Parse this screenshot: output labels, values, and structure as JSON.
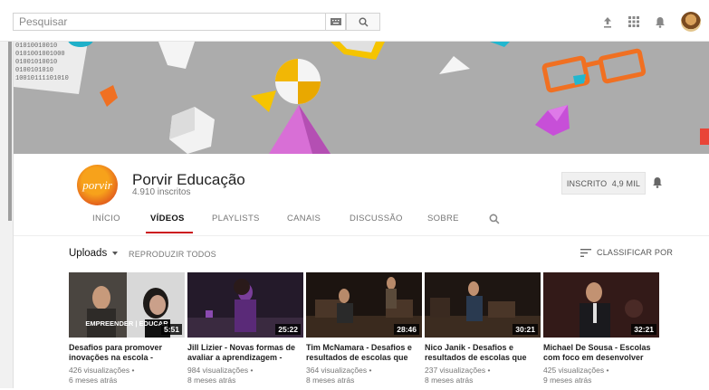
{
  "search": {
    "placeholder": "Pesquisar"
  },
  "channel": {
    "logo_text": "porvir",
    "name": "Porvir Educação",
    "subscribers": "4.910 inscritos",
    "subscribe_label": "INSCRITO  4,9 MIL"
  },
  "tabs": [
    "INÍCIO",
    "VÍDEOS",
    "PLAYLISTS",
    "CANAIS",
    "DISCUSSÃO",
    "SOBRE"
  ],
  "active_tab": "VÍDEOS",
  "toolbar": {
    "uploads_label": "Uploads",
    "play_all_label": "REPRODUZIR TODOS",
    "sort_label": "CLASSIFICAR POR"
  },
  "videos": [
    {
      "title": "Desafios para promover inovações na escola -",
      "views": "426 visualizações •",
      "age": "6 meses atrás",
      "duration": "5:51",
      "overlay": "EMPREENDER | EDUCAR"
    },
    {
      "title": "Jill Lizier - Novas formas de avaliar a aprendizagem -",
      "views": "984 visualizações •",
      "age": "8 meses atrás",
      "duration": "25:22",
      "overlay": ""
    },
    {
      "title": "Tim McNamara - Desafios e resultados de escolas que",
      "views": "364 visualizações •",
      "age": "8 meses atrás",
      "duration": "28:46",
      "overlay": ""
    },
    {
      "title": "Nico Janik - Desafios e resultados de escolas que",
      "views": "237 visualizações •",
      "age": "8 meses atrás",
      "duration": "30:21",
      "overlay": ""
    },
    {
      "title": "Michael De Sousa - Escolas com foco em desenvolver",
      "views": "425 visualizações •",
      "age": "9 meses atrás",
      "duration": "32:21",
      "overlay": ""
    }
  ],
  "banner": {
    "binary_text": [
      "01010010010",
      "0101001001000",
      "01001010010",
      "0100101010",
      "10010111101010"
    ]
  },
  "colors": {
    "accent": "#cc181e",
    "banner_bg": "#a9a9a9",
    "logo_orange": "#f7a21b"
  }
}
